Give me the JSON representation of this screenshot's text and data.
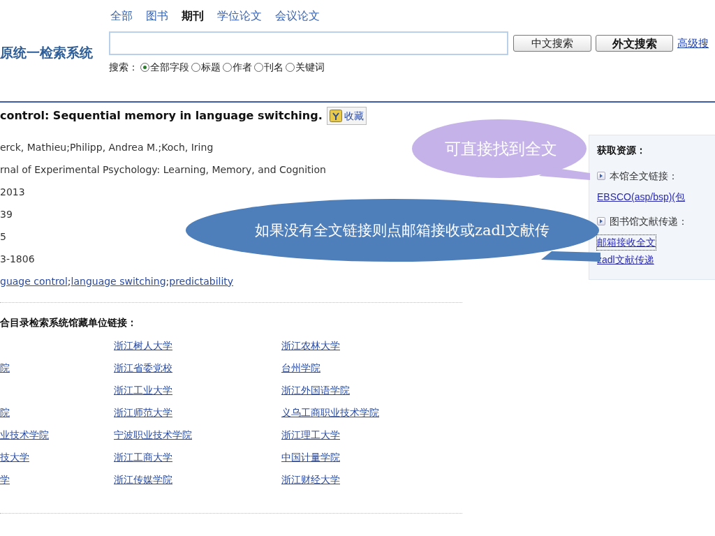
{
  "logo": "原统一检索系统",
  "tabs": [
    {
      "label": "全部",
      "selected": false
    },
    {
      "label": "图书",
      "selected": false
    },
    {
      "label": "期刊",
      "selected": true
    },
    {
      "label": "学位论文",
      "selected": false
    },
    {
      "label": "会议论文",
      "selected": false
    }
  ],
  "search": {
    "buttons": [
      "中文搜索",
      "外文搜索"
    ],
    "advanced_link": "高级搜",
    "scope_label": "搜索：",
    "scopes": [
      {
        "label": "全部字段",
        "selected": true
      },
      {
        "label": "标题",
        "selected": false
      },
      {
        "label": "作者",
        "selected": false
      },
      {
        "label": "刊名",
        "selected": false
      },
      {
        "label": "关键词",
        "selected": false
      }
    ]
  },
  "record": {
    "title": "control: Sequential memory in language switching.",
    "favorite_button": "收藏",
    "fields": [
      "erck, Mathieu;Philipp, Andrea M.;Koch, Iring",
      "rnal of Experimental Psychology: Learning, Memory, and Cognition",
      "2013",
      "39",
      "5",
      "3-1806"
    ],
    "keywords": [
      "guage control",
      "language switching",
      "predictability"
    ],
    "keyword_separator": ";"
  },
  "holdings": {
    "heading": "合目录检索系统馆藏单位链接：",
    "rows": [
      [
        "",
        "浙江树人大学",
        "浙江农林大学"
      ],
      [
        "院",
        "浙江省委党校",
        "台州学院"
      ],
      [
        "",
        "浙江工业大学",
        "浙江外国语学院"
      ],
      [
        "院",
        "浙江师范大学",
        "义乌工商职业技术学院"
      ],
      [
        "业技术学院",
        "宁波职业技术学院",
        "浙江理工大学"
      ],
      [
        "技大学",
        "浙江工商大学",
        "中国计量学院"
      ],
      [
        "学",
        "浙江传媒学院",
        "浙江财经大学"
      ]
    ]
  },
  "resources": {
    "heading": "获取资源：",
    "sections": [
      {
        "label": "本馆全文链接：",
        "links": [
          {
            "text": "EBSCO(asp/bsp)(包",
            "focused": false
          }
        ]
      },
      {
        "label": "图书馆文献传递：",
        "links": [
          {
            "text": "邮箱接收全文",
            "focused": true
          },
          {
            "text": "zadl文献传递",
            "focused": false
          }
        ]
      }
    ]
  },
  "callouts": [
    {
      "text": "可直接找到全文",
      "color": "#c4b2e8"
    },
    {
      "text": "如果没有全文链接则点邮箱接收或zadl文献传",
      "color": "#4f7fba"
    }
  ]
}
